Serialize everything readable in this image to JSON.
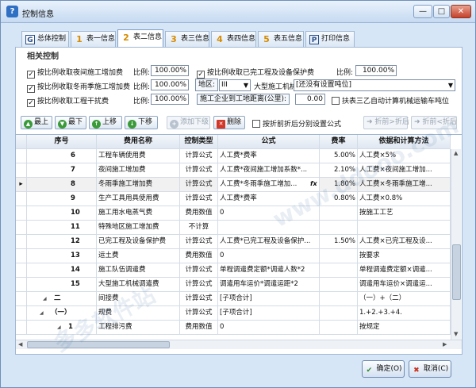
{
  "window": {
    "title": "控制信息",
    "minimize": "—",
    "maximize": "□",
    "close": "✕"
  },
  "tabs": [
    {
      "icon_text": "G",
      "label": "总体控制"
    },
    {
      "icon_text": "1",
      "label": "表一信息"
    },
    {
      "icon_text": "2",
      "label": "表二信息"
    },
    {
      "icon_text": "3",
      "label": "表三信息"
    },
    {
      "icon_text": "4",
      "label": "表四信息"
    },
    {
      "icon_text": "5",
      "label": "表五信息"
    },
    {
      "icon_text": "P",
      "label": "打印信息"
    }
  ],
  "related": {
    "group_title": "相关控制",
    "cb_night": "按比例收取夜间施工增加费",
    "cb_night_checked": "✓",
    "ratio_label": "比例:",
    "ratio_night": "100.00%",
    "cb_completed": "按比例收取已完工程及设备保护费",
    "cb_completed_checked": "✓",
    "ratio_completed": "100.00%",
    "cb_winter": "按比例收取冬雨季施工增加费",
    "cb_winter_checked": "✓",
    "ratio_winter": "100.00%",
    "region_label": "地区:",
    "region_value": "III",
    "machinery_label": "大型施工机械:",
    "machinery_value": "[还没有设置吨位]",
    "cb_interference": "按比例收取工程干扰费",
    "cb_interference_checked": "✓",
    "ratio_interference": "100.00%",
    "distance_label": "施工企业到工地距离(公里):",
    "distance_value": "0.00",
    "cb_auto_calc": "扶表三乙自动计算机械运输车吨位",
    "dropdown_arrow": "▼"
  },
  "toolbar": {
    "top": "最上",
    "bottom": "最下",
    "up": "上移",
    "down": "下移",
    "add": "添加下级",
    "delete": "删除",
    "cb_discount": "按折前折后分别设置公式",
    "before_after": "折前>折后",
    "after_before": "折前<折后"
  },
  "grid": {
    "headers": {
      "seq": "序号",
      "name": "费用名称",
      "ctrl": "控制类型",
      "formula": "公式",
      "rate": "费率",
      "basis": "依据和计算方法"
    },
    "rows": [
      {
        "seq": "6",
        "name": "工程车辆使用费",
        "ctrl": "计算公式",
        "formula": "人工费*费率",
        "rate": "5.00%",
        "basis": "人工费×5%"
      },
      {
        "seq": "7",
        "name": "夜间施工增加费",
        "ctrl": "计算公式",
        "formula": "人工费*夜间施工增加系数*...",
        "rate": "2.10%",
        "basis": "人工费×夜间施工增加..."
      },
      {
        "seq": "8",
        "name": "冬雨季施工增加费",
        "ctrl": "计算公式",
        "formula": "人工费*冬雨季施工增加...",
        "rate": "1.80%",
        "basis": "人工费×冬雨季施工增..."
      },
      {
        "seq": "9",
        "name": "生产工具用具使用费",
        "ctrl": "计算公式",
        "formula": "人工费*费率",
        "rate": "0.80%",
        "basis": "人工费×0.8%"
      },
      {
        "seq": "10",
        "name": "施工用水电蒸气费",
        "ctrl": "费用数值",
        "formula": "0",
        "rate": "",
        "basis": "按施工工艺"
      },
      {
        "seq": "11",
        "name": "特殊地区施工增加费",
        "ctrl": "不计算",
        "formula": "",
        "rate": "",
        "basis": ""
      },
      {
        "seq": "12",
        "name": "已完工程及设备保护费",
        "ctrl": "计算公式",
        "formula": "人工费*已完工程及设备保护...",
        "rate": "1.50%",
        "basis": "人工费×已完工程及设..."
      },
      {
        "seq": "13",
        "name": "运土费",
        "ctrl": "费用数值",
        "formula": "0",
        "rate": "",
        "basis": "按要求"
      },
      {
        "seq": "14",
        "name": "施工队伍调遣费",
        "ctrl": "计算公式",
        "formula": "单程调遣费定额*调遣人数*2",
        "rate": "",
        "basis": "单程调遣费定额×调遣..."
      },
      {
        "seq": "15",
        "name": "大型施工机械调遣费",
        "ctrl": "计算公式",
        "formula": "调遣用车运价*调遣运距*2",
        "rate": "",
        "basis": "调遣用车运价×调遣运..."
      },
      {
        "seq": "二",
        "name": "间接费",
        "ctrl": "计算公式",
        "formula": "[子项合计]",
        "rate": "",
        "basis": "（一）+（二）"
      },
      {
        "seq": "（一）",
        "name": "规费",
        "ctrl": "计算公式",
        "formula": "[子项合计]",
        "rate": "",
        "basis": "1.+2.+3.+4."
      },
      {
        "seq": "1",
        "name": "工程排污费",
        "ctrl": "费用数值",
        "formula": "0",
        "rate": "",
        "basis": "按规定"
      }
    ],
    "row_indicator": "▸",
    "fx": "fx",
    "tree_toggle": "◢"
  },
  "dialog": {
    "ok": "确定(O)",
    "cancel": "取消(C)"
  }
}
